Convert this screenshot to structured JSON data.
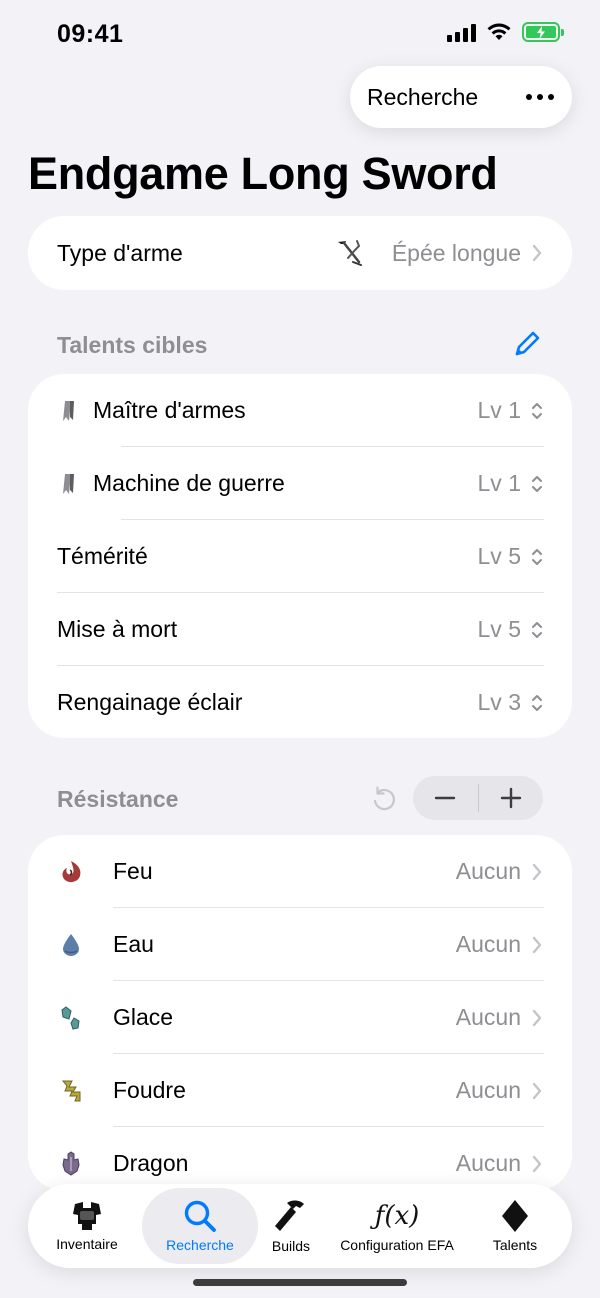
{
  "status": {
    "time": "09:41"
  },
  "top_pill": {
    "label": "Recherche"
  },
  "page": {
    "title": "Endgame Long Sword"
  },
  "weapon": {
    "label": "Type d'arme",
    "value": "Épée longue",
    "icon": "long-sword-icon"
  },
  "talents": {
    "header": "Talents cibles",
    "items": [
      {
        "label": "Maître d'armes",
        "level": "Lv 1",
        "icon": "bookmark-icon"
      },
      {
        "label": "Machine de guerre",
        "level": "Lv 1",
        "icon": "bookmark-icon"
      },
      {
        "label": "Témérité",
        "level": "Lv 5"
      },
      {
        "label": "Mise à mort",
        "level": "Lv 5"
      },
      {
        "label": "Rengainage éclair",
        "level": "Lv 3"
      }
    ]
  },
  "resistance": {
    "header": "Résistance",
    "items": [
      {
        "label": "Feu",
        "value": "Aucun",
        "icon": "fire-icon",
        "color": "#a43a3a"
      },
      {
        "label": "Eau",
        "value": "Aucun",
        "icon": "water-icon",
        "color": "#5b7fa8"
      },
      {
        "label": "Glace",
        "value": "Aucun",
        "icon": "ice-icon",
        "color": "#5a9a96"
      },
      {
        "label": "Foudre",
        "value": "Aucun",
        "icon": "thunder-icon",
        "color": "#b9a93d"
      },
      {
        "label": "Dragon",
        "value": "Aucun",
        "icon": "dragon-icon",
        "color": "#7a6a8e"
      }
    ]
  },
  "tabs": [
    {
      "label": "Inventaire",
      "icon": "armor-icon"
    },
    {
      "label": "Recherche",
      "icon": "search-icon",
      "active": true
    },
    {
      "label": "Builds",
      "icon": "hammer-icon"
    },
    {
      "label": "Configuration EFA",
      "icon": "function-icon",
      "glyph": "ƒ(x)"
    },
    {
      "label": "Talents",
      "icon": "diamond-icon"
    }
  ],
  "colors": {
    "accent": "#007aff",
    "background": "#f2f2f7",
    "secondary_text": "#8e8e93"
  }
}
